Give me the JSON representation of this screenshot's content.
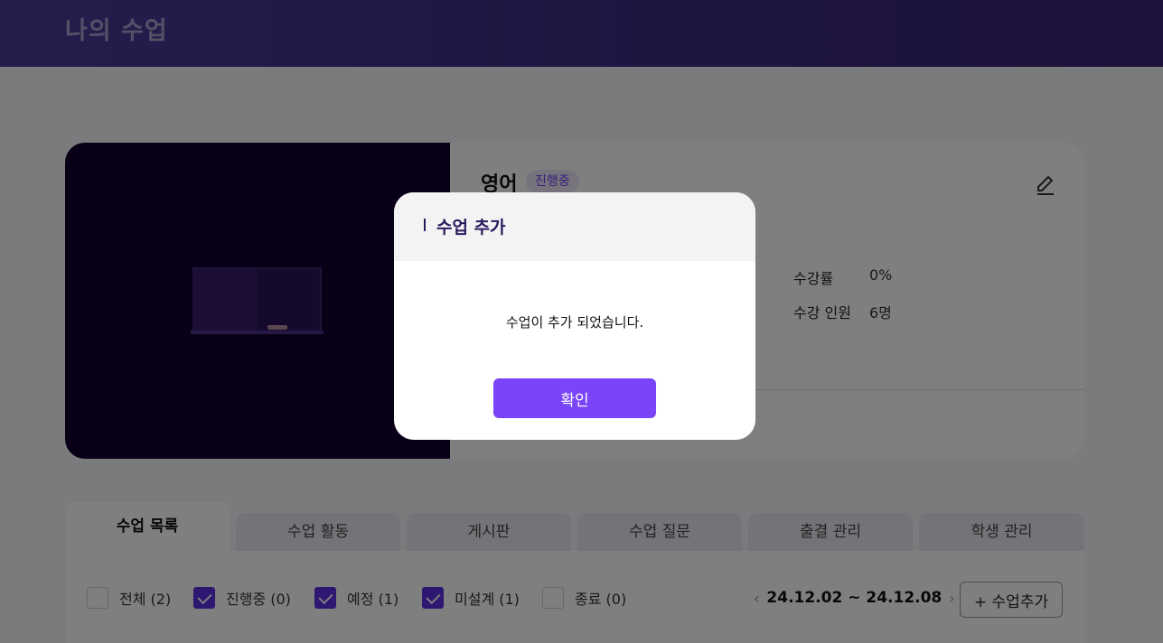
{
  "header": {
    "title": "나의 수업"
  },
  "course": {
    "name": "영어",
    "status": "진행중",
    "meta": [
      {
        "label": "수강률",
        "value": "0%"
      },
      {
        "label": "수강 인원",
        "value": "6명"
      }
    ]
  },
  "tabs": [
    "수업 목록",
    "수업 활동",
    "게시판",
    "수업 질문",
    "출결 관리",
    "학생 관리"
  ],
  "filters": [
    {
      "label": "전체 (2)",
      "checked": false
    },
    {
      "label": "진행중 (0)",
      "checked": true
    },
    {
      "label": "예정 (1)",
      "checked": true
    },
    {
      "label": "미설계 (1)",
      "checked": true
    },
    {
      "label": "종료 (0)",
      "checked": false
    }
  ],
  "date_range": "24.12.02 ~ 24.12.08",
  "add_course_label": "+ 수업추가",
  "icons": {
    "prev": "chevron-left-icon",
    "next": "chevron-right-icon",
    "edit": "pencil-icon"
  },
  "colors": {
    "accent": "#7a45f8",
    "checkbox": "#5a2fe0",
    "header": "#3d2f86"
  },
  "modal": {
    "title": "수업 추가",
    "message": "수업이 추가 되었습니다.",
    "confirm_label": "확인"
  }
}
